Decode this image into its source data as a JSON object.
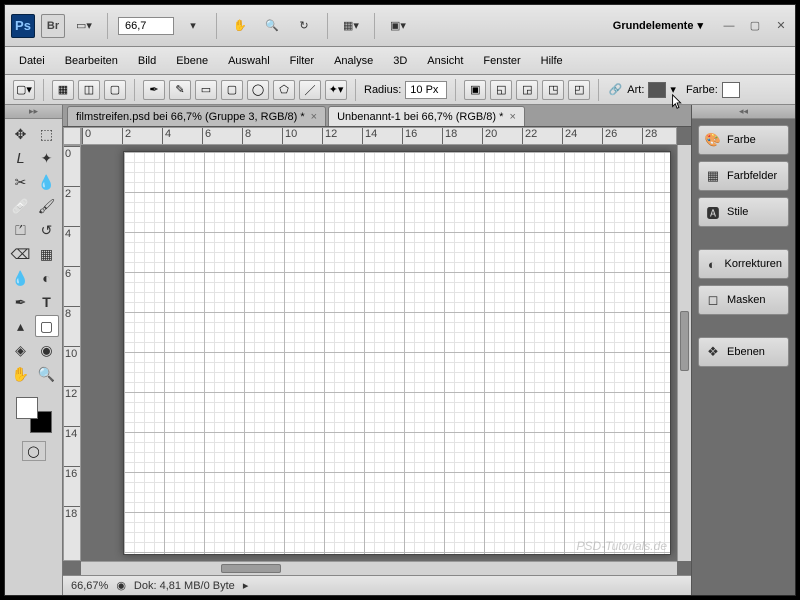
{
  "topbar": {
    "zoom": "66,7",
    "workspace": "Grundelemente"
  },
  "menu": {
    "items": [
      "Datei",
      "Bearbeiten",
      "Bild",
      "Ebene",
      "Auswahl",
      "Filter",
      "Analyse",
      "3D",
      "Ansicht",
      "Fenster",
      "Hilfe"
    ]
  },
  "options": {
    "radius_label": "Radius:",
    "radius_value": "10 Px",
    "art_label": "Art:",
    "farbe_label": "Farbe:"
  },
  "tabs": {
    "items": [
      {
        "label": "filmstreifen.psd bei 66,7% (Gruppe 3, RGB/8) *",
        "active": false
      },
      {
        "label": "Unbenannt-1 bei 66,7% (RGB/8) *",
        "active": true
      }
    ]
  },
  "ruler": {
    "h": [
      "0",
      "2",
      "4",
      "6",
      "8",
      "10",
      "12",
      "14",
      "16",
      "18",
      "20",
      "22",
      "24",
      "26",
      "28"
    ],
    "v": [
      "0",
      "2",
      "4",
      "6",
      "8",
      "10",
      "12",
      "14",
      "16",
      "18"
    ]
  },
  "status": {
    "zoom": "66,67%",
    "doc": "Dok: 4,81 MB/0 Byte"
  },
  "panels": {
    "items": [
      "Farbe",
      "Farbfelder",
      "Stile",
      "Korrekturen",
      "Masken",
      "Ebenen"
    ]
  },
  "watermark": "PSD-Tutorials.de"
}
